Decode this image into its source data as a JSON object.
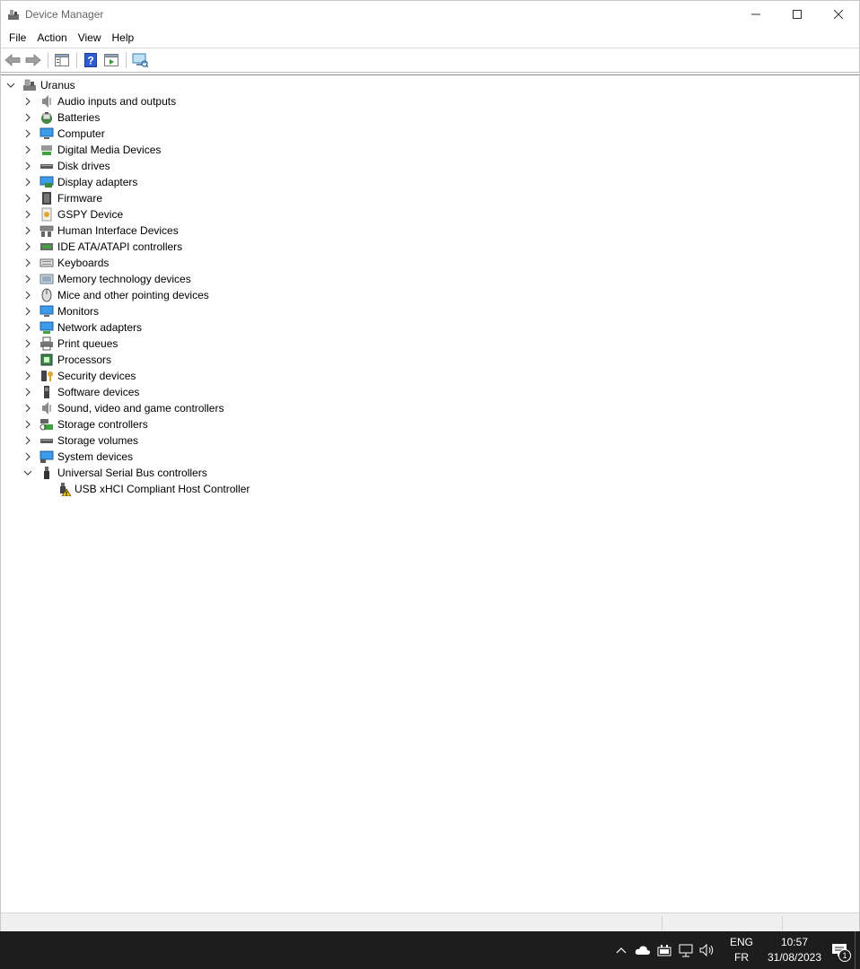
{
  "window": {
    "title": "Device Manager"
  },
  "menu": [
    "File",
    "Action",
    "View",
    "Help"
  ],
  "toolbar": {
    "icons": [
      "back-icon",
      "forward-icon",
      "show-hide-console-tree-icon",
      "help-icon",
      "properties-icon",
      "scan-hardware-icon"
    ]
  },
  "tree": {
    "root": "Uranus",
    "categories": [
      {
        "label": "Audio inputs and outputs",
        "icon": "speaker-icon"
      },
      {
        "label": "Batteries",
        "icon": "battery-icon"
      },
      {
        "label": "Computer",
        "icon": "computer-icon"
      },
      {
        "label": "Digital Media Devices",
        "icon": "media-device-icon"
      },
      {
        "label": "Disk drives",
        "icon": "disk-drive-icon"
      },
      {
        "label": "Display adapters",
        "icon": "display-adapter-icon"
      },
      {
        "label": "Firmware",
        "icon": "firmware-icon"
      },
      {
        "label": "GSPY Device",
        "icon": "gspy-device-icon"
      },
      {
        "label": "Human Interface Devices",
        "icon": "hid-icon"
      },
      {
        "label": "IDE ATA/ATAPI controllers",
        "icon": "ide-controller-icon"
      },
      {
        "label": "Keyboards",
        "icon": "keyboard-icon"
      },
      {
        "label": "Memory technology devices",
        "icon": "memory-icon"
      },
      {
        "label": "Mice and other pointing devices",
        "icon": "mouse-icon"
      },
      {
        "label": "Monitors",
        "icon": "monitor-icon"
      },
      {
        "label": "Network adapters",
        "icon": "network-adapter-icon"
      },
      {
        "label": "Print queues",
        "icon": "printer-icon"
      },
      {
        "label": "Processors",
        "icon": "processor-icon"
      },
      {
        "label": "Security devices",
        "icon": "security-device-icon"
      },
      {
        "label": "Software devices",
        "icon": "software-device-icon"
      },
      {
        "label": "Sound, video and game controllers",
        "icon": "sound-controller-icon"
      },
      {
        "label": "Storage controllers",
        "icon": "storage-controller-icon"
      },
      {
        "label": "Storage volumes",
        "icon": "storage-volume-icon"
      },
      {
        "label": "System devices",
        "icon": "system-device-icon"
      },
      {
        "label": "Universal Serial Bus controllers",
        "icon": "usb-icon",
        "expanded": true
      }
    ],
    "usb_children": [
      {
        "label": "USB xHCI Compliant Host Controller",
        "icon": "usb-warning-icon"
      }
    ]
  },
  "taskbar": {
    "language_line1": "ENG",
    "language_line2": "FR",
    "time": "10:57",
    "date": "31/08/2023",
    "notification_count": "1"
  }
}
